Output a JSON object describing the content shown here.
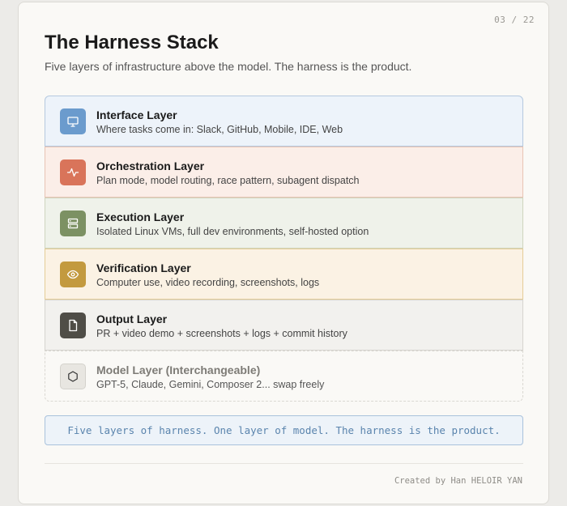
{
  "slide": {
    "page_number": "03 / 22",
    "title": "The Harness Stack",
    "subtitle": "Five layers of infrastructure above the model. The harness is the product."
  },
  "layers": [
    {
      "name": "Interface Layer",
      "description": "Where tasks come in: Slack, GitHub, Mobile, IDE, Web",
      "icon": "monitor-icon",
      "color": "#6b9bcd"
    },
    {
      "name": "Orchestration Layer",
      "description": "Plan mode, model routing, race pattern, subagent dispatch",
      "icon": "pulse-icon",
      "color": "#d9745a"
    },
    {
      "name": "Execution Layer",
      "description": "Isolated Linux VMs, full dev environments, self-hosted option",
      "icon": "server-icon",
      "color": "#7c9163"
    },
    {
      "name": "Verification Layer",
      "description": "Computer use, video recording, screenshots, logs",
      "icon": "eye-icon",
      "color": "#c39a3f"
    },
    {
      "name": "Output Layer",
      "description": "PR + video demo + screenshots + logs + commit history",
      "icon": "file-icon",
      "color": "#4f4d47"
    },
    {
      "name": "Model Layer (Interchangeable)",
      "description": "GPT-5, Claude, Gemini, Composer 2... swap freely",
      "icon": "hexagon-icon",
      "color": "#e8e6e1"
    }
  ],
  "banner": "Five layers of harness. One layer of model. The harness is the product.",
  "credit": "Created by Han HELOIR YAN"
}
